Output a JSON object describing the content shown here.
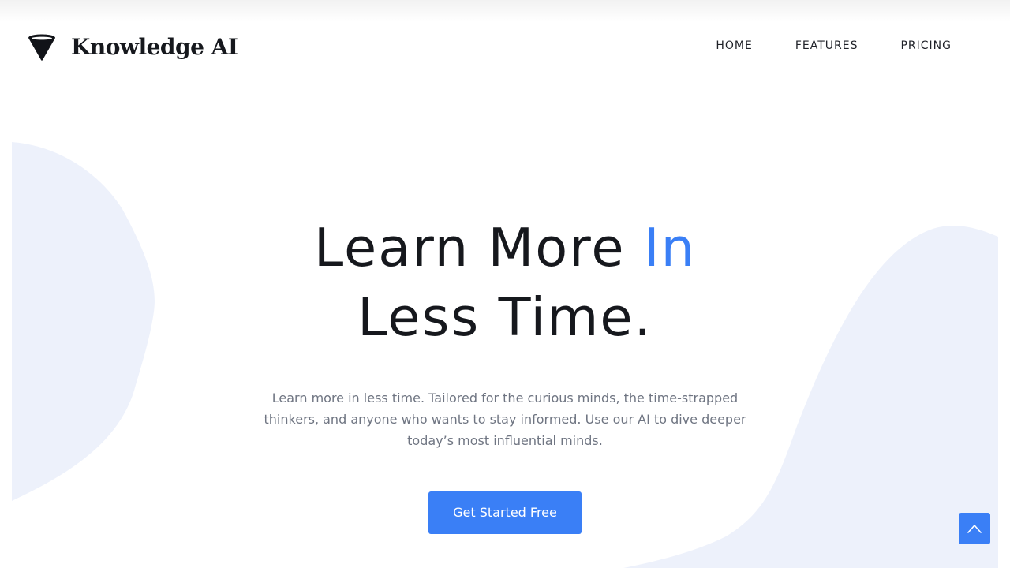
{
  "brand": {
    "name": "Knowledge AI",
    "icon": "cone-logo-icon"
  },
  "nav": {
    "items": [
      {
        "label": "HOME"
      },
      {
        "label": "FEATURES"
      },
      {
        "label": "PRICING"
      }
    ]
  },
  "hero": {
    "title_line1_main": "Learn More ",
    "title_line1_accent": "In",
    "title_line2": "Less Time.",
    "subtitle": "Learn more in less time. Tailored for the curious minds, the time-strapped thinkers, and anyone who wants to stay informed. Use our AI to dive deeper today’s most influential minds.",
    "cta_label": "Get Started Free"
  },
  "scroll_top": {
    "icon": "chevron-up-icon"
  },
  "colors": {
    "accent": "#3a7ff6",
    "text_dark": "#16181d",
    "text_muted": "#6f7582",
    "blob": "#edf1fb"
  }
}
